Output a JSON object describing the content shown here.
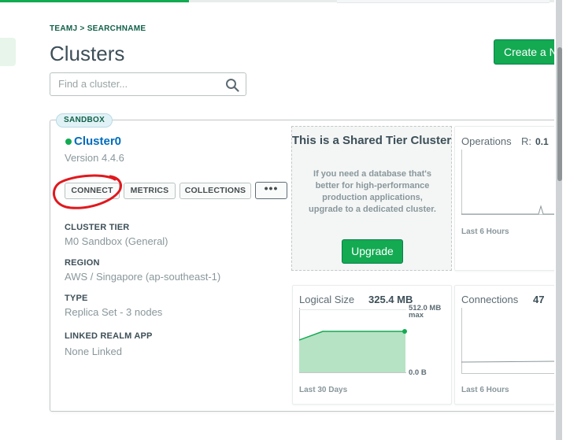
{
  "breadcrumb": "TEAMJ > SEARCHNAME",
  "page_title": "Clusters",
  "create_button": "Create a N",
  "search": {
    "placeholder": "Find a cluster..."
  },
  "cluster": {
    "badge": "SANDBOX",
    "name": "Cluster0",
    "version": "Version 4.4.6",
    "status_color": "#13aa52",
    "buttons": {
      "connect": "CONNECT",
      "metrics": "METRICS",
      "collections": "COLLECTIONS",
      "more": "•••"
    },
    "details": [
      {
        "label": "CLUSTER TIER",
        "value": "M0 Sandbox (General)"
      },
      {
        "label": "REGION",
        "value": "AWS / Singapore (ap-southeast-1)"
      },
      {
        "label": "TYPE",
        "value": "Replica Set - 3 nodes"
      },
      {
        "label": "LINKED REALM APP",
        "value": "None Linked"
      }
    ]
  },
  "upgrade": {
    "title": "This is a Shared Tier Cluster",
    "description": "If you need a database that's better for high-performance production applications, upgrade to a dedicated cluster.",
    "button": "Upgrade"
  },
  "metrics": {
    "operations": {
      "title": "Operations",
      "value_label": "R:",
      "value": "0.1",
      "range": "Last 6 Hours"
    },
    "logical_size": {
      "title": "Logical Size",
      "value": "325.4 MB",
      "max_label": "512.0 MB",
      "max_suffix": "max",
      "min_label": "0.0 B",
      "range": "Last 30 Days"
    },
    "connections": {
      "title": "Connections",
      "value": "47",
      "range": "Last 6 Hours"
    }
  },
  "accent_color": "#13aa52",
  "link_color": "#006cbc"
}
